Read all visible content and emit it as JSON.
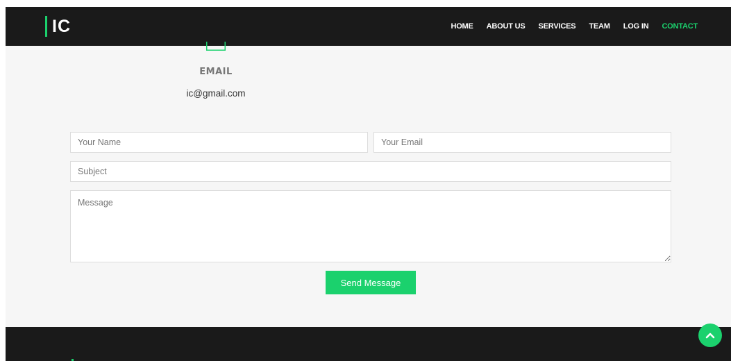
{
  "brand": {
    "logo_text": "IC"
  },
  "nav": {
    "items": [
      {
        "label": "HOME"
      },
      {
        "label": "ABOUT US"
      },
      {
        "label": "SERVICES"
      },
      {
        "label": "TEAM"
      },
      {
        "label": "LOG IN"
      },
      {
        "label": "CONTACT",
        "active": true
      }
    ]
  },
  "contact_info": {
    "icon": "envelope-icon",
    "label": "EMAIL",
    "value": "ic@gmail.com"
  },
  "form": {
    "name_placeholder": "Your Name",
    "email_placeholder": "Your Email",
    "subject_placeholder": "Subject",
    "message_placeholder": "Message",
    "submit_label": "Send Message"
  },
  "back_to_top": {
    "icon": "chevron-up-icon"
  },
  "colors": {
    "accent": "#1bd16d",
    "dark": "#1a1a1a",
    "background": "#f6f6f6"
  }
}
